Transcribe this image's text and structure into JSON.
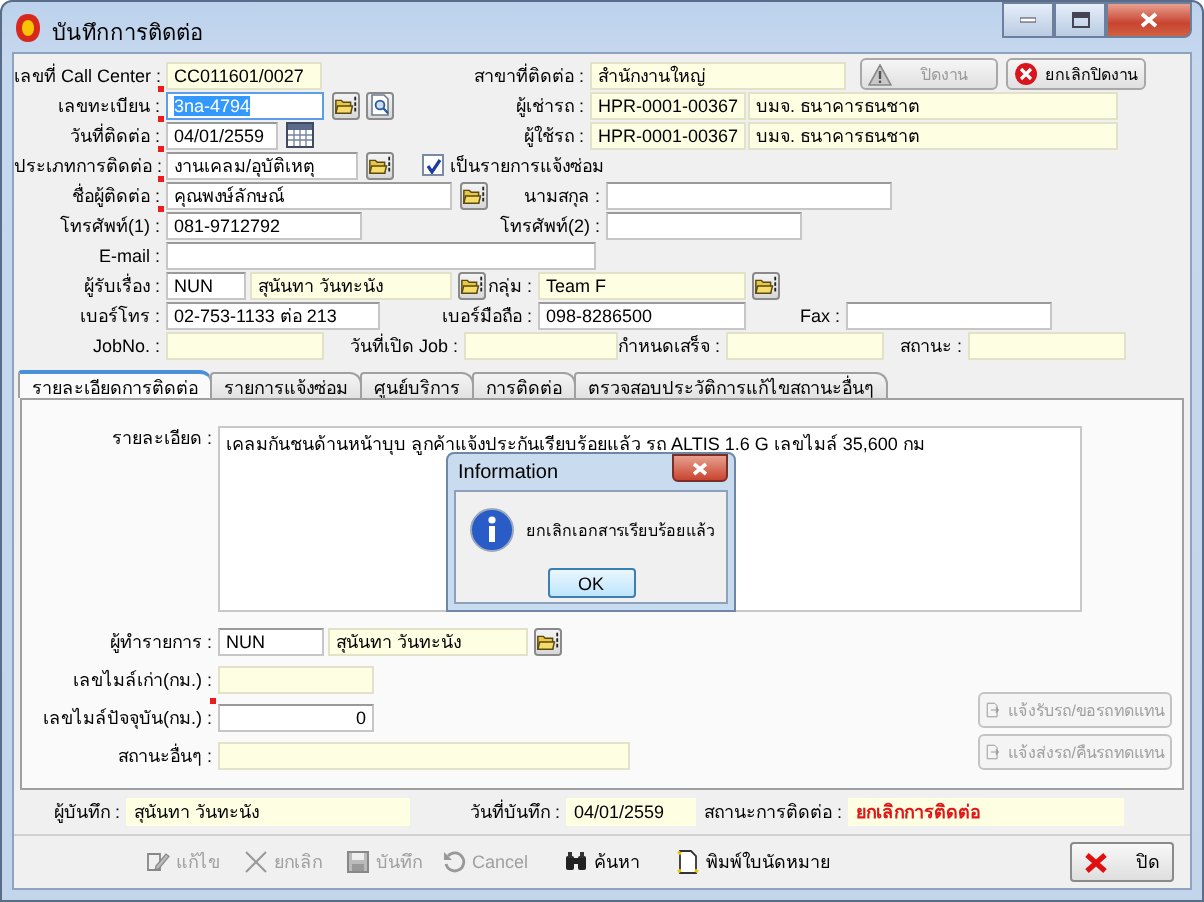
{
  "window": {
    "title": "บันทึกการติดต่อ"
  },
  "header_rows": [
    [
      {
        "kind": "field",
        "label": "เลขที่ Call Center :",
        "value": "CC011601/0027",
        "readonly": true,
        "required": false,
        "focused": false
      },
      {
        "kind": "field",
        "label": "สาขาที่ติดต่อ :",
        "value": "สำนักงานใหญ่",
        "readonly": true,
        "required": false,
        "focused": false
      },
      {
        "kind": "button",
        "label": "ปิดงาน",
        "disabled": true
      },
      {
        "kind": "button",
        "label": "ยกเลิกปิดงาน",
        "disabled": false
      }
    ],
    [
      {
        "kind": "field",
        "label": "เลขทะเบียน :",
        "value": "3na-4794",
        "readonly": false,
        "required": true,
        "focused": true
      },
      {
        "kind": "lookup"
      },
      {
        "kind": "preview"
      },
      {
        "kind": "field",
        "label": "ผู้เช่ารถ :",
        "value": "HPR-0001-00367",
        "readonly": true,
        "required": false,
        "focused": false
      },
      {
        "kind": "field",
        "value": "บมจ. ธนาคารธนชาต",
        "readonly": true,
        "required": false,
        "focused": false
      }
    ],
    [
      {
        "kind": "field",
        "label": "วันที่ติดต่อ :",
        "value": "04/01/2559",
        "readonly": false,
        "required": true,
        "focused": false
      },
      {
        "kind": "calendar"
      },
      {
        "kind": "field",
        "label": "ผู้ใช้รถ :",
        "value": "HPR-0001-00367",
        "readonly": true,
        "required": false,
        "focused": false
      },
      {
        "kind": "field",
        "value": "บมจ. ธนาคารธนชาต",
        "readonly": true,
        "required": false,
        "focused": false
      }
    ],
    [
      {
        "kind": "field",
        "label": "ประเภทการติดต่อ :",
        "value": "งานเคลม/อุบัติเหตุ",
        "readonly": false,
        "required": true,
        "focused": false
      },
      {
        "kind": "lookup"
      },
      {
        "kind": "checkbox",
        "label": "เป็นรายการแจ้งซ่อม",
        "checked": true
      }
    ],
    [
      {
        "kind": "field",
        "label": "ชื่อผู้ติดต่อ :",
        "value": "คุณพงษ์ลักษณ์",
        "readonly": false,
        "required": true,
        "focused": false
      },
      {
        "kind": "lookup"
      },
      {
        "kind": "field",
        "label": "นามสกุล :",
        "readonly": false,
        "required": false,
        "focused": false
      }
    ],
    [
      {
        "kind": "field",
        "label": "โทรศัพท์(1) :",
        "value": "081-9712792",
        "readonly": false,
        "required": true,
        "focused": false
      },
      {
        "kind": "field",
        "label": "โทรศัพท์(2) :",
        "readonly": false,
        "required": false,
        "focused": false
      }
    ],
    [
      {
        "kind": "field",
        "label": "E-mail :",
        "readonly": false,
        "required": false,
        "focused": false
      }
    ],
    [
      {
        "kind": "field",
        "label": "ผู้รับเรื่อง :",
        "value": "NUN",
        "readonly": false,
        "required": false,
        "focused": false
      },
      {
        "kind": "field",
        "value": "สุนันทา วันทะนัง",
        "readonly": true,
        "required": false,
        "focused": false
      },
      {
        "kind": "lookup"
      },
      {
        "kind": "field",
        "label": "กลุ่ม :",
        "value": "Team F",
        "readonly": true,
        "required": false,
        "focused": false
      },
      {
        "kind": "lookup"
      }
    ],
    [
      {
        "kind": "field",
        "label": "เบอร์โทร :",
        "value": "02-753-1133 ต่อ 213",
        "readonly": false,
        "required": false,
        "focused": false
      },
      {
        "kind": "field",
        "label": "เบอร์มือถือ :",
        "value": "098-8286500",
        "readonly": false,
        "required": false,
        "focused": false
      },
      {
        "kind": "field",
        "label": "Fax :",
        "readonly": false,
        "required": false,
        "focused": false
      }
    ],
    [
      {
        "kind": "field",
        "label": "JobNo. :",
        "readonly": true,
        "required": false,
        "focused": false
      },
      {
        "kind": "field",
        "label": "วันที่เปิด Job :",
        "readonly": true,
        "required": false,
        "focused": false
      },
      {
        "kind": "field",
        "label": "กำหนดเสร็จ :",
        "readonly": true,
        "required": false,
        "focused": false
      },
      {
        "kind": "field",
        "label": "สถานะ :",
        "readonly": true,
        "required": false,
        "focused": false
      }
    ]
  ],
  "tabs": [
    {
      "label": "รายละเอียดการติดต่อ",
      "selected": true
    },
    {
      "label": "รายการแจ้งซ่อม",
      "selected": false
    },
    {
      "label": "ศูนย์บริการ",
      "selected": false
    },
    {
      "label": "การติดต่อ",
      "selected": false
    },
    {
      "label": "ตรวจสอบประวัติการแก้ไขสถานะอื่นๆ",
      "selected": false
    }
  ],
  "panel": {
    "detail": {
      "label": "รายละเอียด :",
      "value": "เคลมกันชนด้านหน้าบุบ  ลูกค้าแจ้งประกันเรียบร้อยแล้ว รถ ALTIS 1.6 G เลขไมล์ 35,600 กม"
    },
    "rows": [
      [
        {
          "kind": "field",
          "label": "ผู้ทำรายการ :",
          "value": "NUN",
          "readonly": false,
          "required": false,
          "focused": false
        },
        {
          "kind": "field",
          "value": "สุนันทา วันทะนัง",
          "readonly": true,
          "required": false,
          "focused": false
        },
        {
          "kind": "lookup"
        }
      ],
      [
        {
          "kind": "field",
          "label": "เลขไมล์เก่า(กม.) :",
          "readonly": true,
          "required": false,
          "focused": false
        }
      ],
      [
        {
          "kind": "number",
          "label": "เลขไมล์ปัจจุบัน(กม.) :",
          "value": "0",
          "readonly": false,
          "required": true,
          "focused": false
        }
      ],
      [
        {
          "kind": "field",
          "label": "สถานะอื่นๆ :",
          "readonly": true,
          "required": false,
          "focused": false
        }
      ]
    ],
    "side_buttons": [
      {
        "label": "แจ้งรับรถ/ขอรถทดแทน",
        "disabled": true
      },
      {
        "label": "แจ้งส่งรถ/คืนรถทดแทน",
        "disabled": true
      }
    ]
  },
  "footer_fields": [
    {
      "label": "ผู้บันทึก :",
      "value": "สุนันทา วันทะนัง",
      "alert": false
    },
    {
      "label": "วันที่บันทึก :",
      "value": "04/01/2559",
      "alert": false
    },
    {
      "label": "สถานะการติดต่อ :",
      "value": "ยกเลิกการติดต่อ",
      "alert": true
    }
  ],
  "toolbar": [
    {
      "label": "แก้ไข",
      "disabled": true
    },
    {
      "label": "ยกเลิก",
      "disabled": true
    },
    {
      "label": "บันทึก",
      "disabled": true
    },
    {
      "label": "Cancel",
      "disabled": true
    },
    {
      "label": "ค้นหา",
      "disabled": false
    },
    {
      "label": "พิมพ์ใบนัดหมาย",
      "disabled": false
    }
  ],
  "close_button": {
    "label": "ปิด"
  },
  "dialog": {
    "title": "Information",
    "message": "ยกเลิกเอกสารเรียบร้อยแล้ว",
    "button": "OK"
  }
}
